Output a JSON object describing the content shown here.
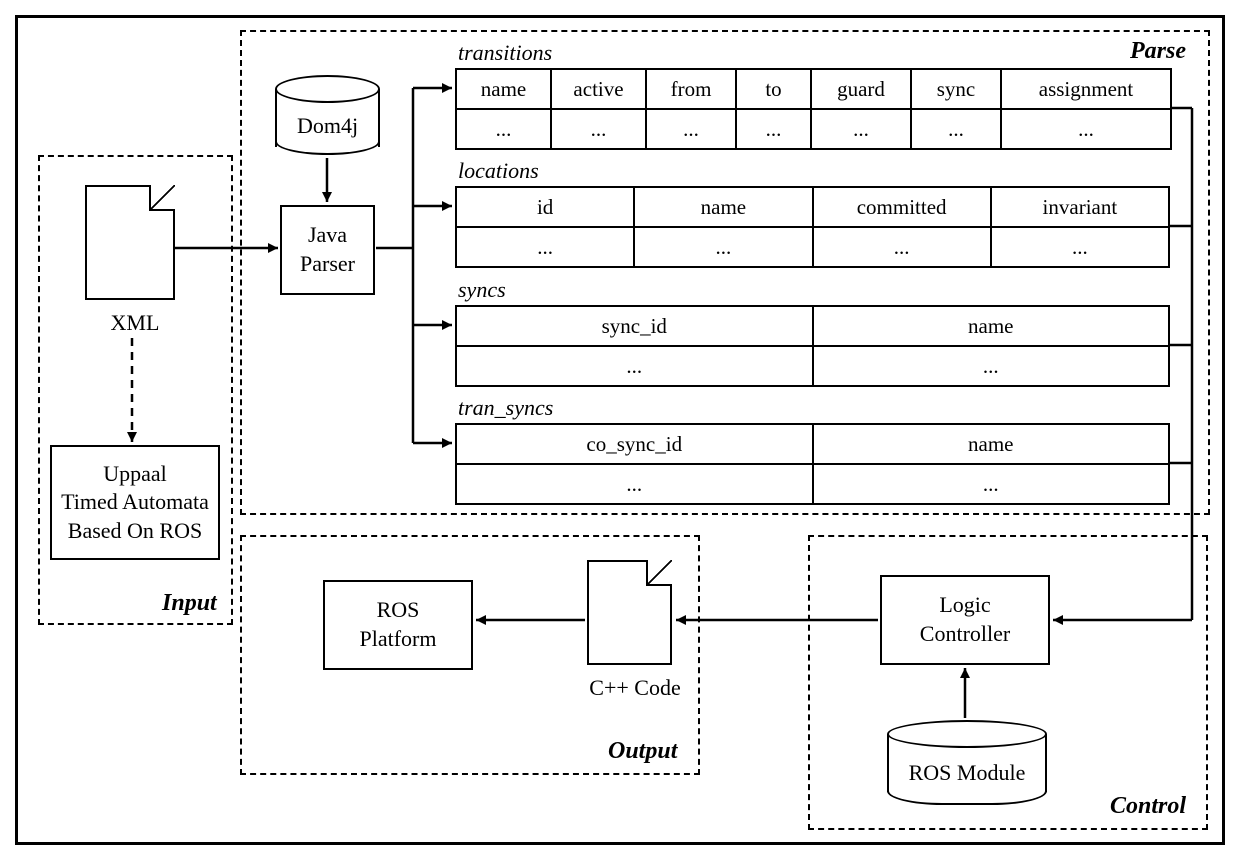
{
  "regions": {
    "input": "Input",
    "parse": "Parse",
    "output": "Output",
    "control": "Control"
  },
  "nodes": {
    "xml": "XML",
    "uppaal_l1": "Uppaal",
    "uppaal_l2": "Timed Automata",
    "uppaal_l3": "Based On ROS",
    "java_parser_l1": "Java",
    "java_parser_l2": "Parser",
    "dom4j": "Dom4j",
    "ros_platform_l1": "ROS",
    "ros_platform_l2": "Platform",
    "cpp_code": "C++ Code",
    "logic_l1": "Logic",
    "logic_l2": "Controller",
    "ros_module": "ROS Module"
  },
  "tables": {
    "transitions": {
      "title": "transitions",
      "headers": [
        "name",
        "active",
        "from",
        "to",
        "guard",
        "sync",
        "assignment"
      ],
      "row": [
        "...",
        "...",
        "...",
        "...",
        "...",
        "...",
        "..."
      ]
    },
    "locations": {
      "title": "locations",
      "headers": [
        "id",
        "name",
        "committed",
        "invariant"
      ],
      "row": [
        "...",
        "...",
        "...",
        "..."
      ]
    },
    "syncs": {
      "title": "syncs",
      "headers": [
        "sync_id",
        "name"
      ],
      "row": [
        "...",
        "..."
      ]
    },
    "tran_syncs": {
      "title": "tran_syncs",
      "headers": [
        "co_sync_id",
        "name"
      ],
      "row": [
        "...",
        "..."
      ]
    }
  }
}
